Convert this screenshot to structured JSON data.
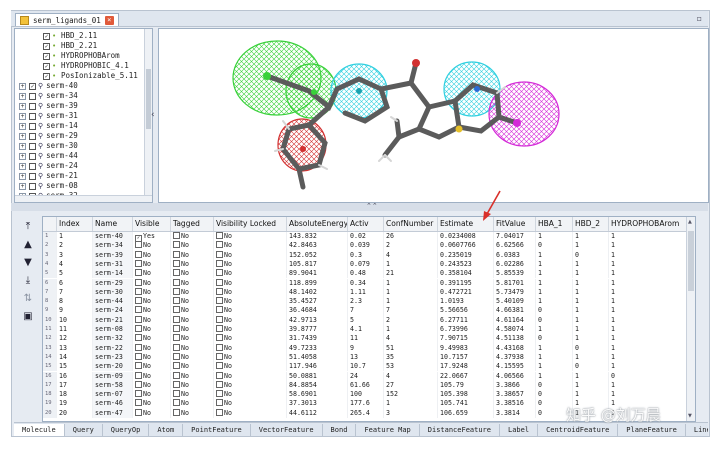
{
  "document_tab": {
    "title": "serm_ligands_01",
    "close": "×"
  },
  "tree": {
    "features": [
      {
        "label": "HBD_2.11",
        "checked": true
      },
      {
        "label": "HBD_2.21",
        "checked": true
      },
      {
        "label": "HYDROPHOBArom",
        "checked": true
      },
      {
        "label": "HYDROPHOBIC_4.1",
        "checked": true
      },
      {
        "label": "PosIonizable_5.11",
        "checked": true
      }
    ],
    "molecules": [
      {
        "label": "serm-40",
        "checked": true
      },
      {
        "label": "serm-34",
        "checked": false
      },
      {
        "label": "serm-39",
        "checked": false
      },
      {
        "label": "serm-31",
        "checked": false
      },
      {
        "label": "serm-14",
        "checked": false
      },
      {
        "label": "serm-29",
        "checked": false
      },
      {
        "label": "serm-30",
        "checked": false
      },
      {
        "label": "serm-44",
        "checked": false
      },
      {
        "label": "serm-24",
        "checked": false
      },
      {
        "label": "serm-21",
        "checked": false
      },
      {
        "label": "serm-08",
        "checked": false
      },
      {
        "label": "serm-32",
        "checked": false
      }
    ]
  },
  "table": {
    "columns": [
      "Index",
      "Name",
      "Visible",
      "Tagged",
      "Visibility Locked",
      "AbsoluteEnergy",
      "Activ",
      "ConfNumber",
      "Estimate",
      "FitValue",
      "HBA_1",
      "HBD_2",
      "HYDROPHOBArom"
    ],
    "rows": [
      [
        "1",
        "serm-40",
        "Yes",
        "No",
        "No",
        "143.832",
        "0.02",
        "26",
        "0.0234008",
        "7.04017",
        "1",
        "1",
        "1"
      ],
      [
        "2",
        "serm-34",
        "No",
        "No",
        "No",
        "42.8463",
        "0.039",
        "2",
        "0.0607766",
        "6.62566",
        "0",
        "1",
        "1"
      ],
      [
        "3",
        "serm-39",
        "No",
        "No",
        "No",
        "152.052",
        "0.3",
        "4",
        "0.235019",
        "6.0383",
        "1",
        "0",
        "1"
      ],
      [
        "4",
        "serm-31",
        "No",
        "No",
        "No",
        "105.817",
        "0.079",
        "1",
        "0.243523",
        "6.02286",
        "1",
        "1",
        "1"
      ],
      [
        "5",
        "serm-14",
        "No",
        "No",
        "No",
        "89.9041",
        "0.48",
        "21",
        "0.358104",
        "5.85539",
        "1",
        "1",
        "1"
      ],
      [
        "6",
        "serm-29",
        "No",
        "No",
        "No",
        "118.899",
        "0.34",
        "1",
        "0.391195",
        "5.81701",
        "1",
        "1",
        "1"
      ],
      [
        "7",
        "serm-30",
        "No",
        "No",
        "No",
        "48.1402",
        "1.11",
        "1",
        "0.472721",
        "5.73479",
        "1",
        "1",
        "1"
      ],
      [
        "8",
        "serm-44",
        "No",
        "No",
        "No",
        "35.4527",
        "2.3",
        "1",
        "1.0193",
        "5.40109",
        "1",
        "1",
        "1"
      ],
      [
        "9",
        "serm-24",
        "No",
        "No",
        "No",
        "36.4684",
        "7",
        "7",
        "5.56656",
        "4.66381",
        "0",
        "1",
        "1"
      ],
      [
        "10",
        "serm-21",
        "No",
        "No",
        "No",
        "42.9713",
        "5",
        "2",
        "6.27711",
        "4.61164",
        "0",
        "1",
        "1"
      ],
      [
        "11",
        "serm-08",
        "No",
        "No",
        "No",
        "39.8777",
        "4.1",
        "1",
        "6.73996",
        "4.58074",
        "1",
        "1",
        "1"
      ],
      [
        "12",
        "serm-32",
        "No",
        "No",
        "No",
        "31.7439",
        "11",
        "4",
        "7.90715",
        "4.51138",
        "0",
        "1",
        "1"
      ],
      [
        "13",
        "serm-22",
        "No",
        "No",
        "No",
        "49.7233",
        "9",
        "51",
        "9.49983",
        "4.43168",
        "1",
        "0",
        "1"
      ],
      [
        "14",
        "serm-23",
        "No",
        "No",
        "No",
        "51.4058",
        "13",
        "35",
        "10.7157",
        "4.37938",
        "1",
        "1",
        "1"
      ],
      [
        "15",
        "serm-20",
        "No",
        "No",
        "No",
        "117.946",
        "10.7",
        "53",
        "17.9248",
        "4.15595",
        "1",
        "0",
        "1"
      ],
      [
        "16",
        "serm-09",
        "No",
        "No",
        "No",
        "50.0881",
        "24",
        "4",
        "22.0667",
        "4.06566",
        "1",
        "1",
        "0"
      ],
      [
        "17",
        "serm-58",
        "No",
        "No",
        "No",
        "84.8854",
        "61.66",
        "27",
        "105.79",
        "3.3866",
        "0",
        "1",
        "1"
      ],
      [
        "18",
        "serm-07",
        "No",
        "No",
        "No",
        "58.6901",
        "100",
        "152",
        "105.398",
        "3.38657",
        "0",
        "1",
        "1"
      ],
      [
        "19",
        "serm-46",
        "No",
        "No",
        "No",
        "37.3013",
        "177.6",
        "1",
        "105.741",
        "3.38516",
        "0",
        "1",
        "1"
      ],
      [
        "20",
        "serm-47",
        "No",
        "No",
        "No",
        "44.6112",
        "265.4",
        "3",
        "106.659",
        "3.3814",
        "0",
        "1",
        "1"
      ]
    ]
  },
  "bottom_tabs": [
    "Molecule",
    "Query",
    "QueryOp",
    "Atom",
    "PointFeature",
    "VectorFeature",
    "Bond",
    "Feature Map",
    "DistanceFeature",
    "Label",
    "CentroidFeature",
    "PlaneFeature",
    "LineFeature"
  ],
  "watermark": "知乎 @刘万晨",
  "colors": {
    "accent_red": "#d9302a",
    "hbd_green": "#39d13a",
    "hydrophobic_cyan": "#2fd0e0",
    "posionizable_magenta": "#d42ad8",
    "hba_red": "#d23030"
  }
}
